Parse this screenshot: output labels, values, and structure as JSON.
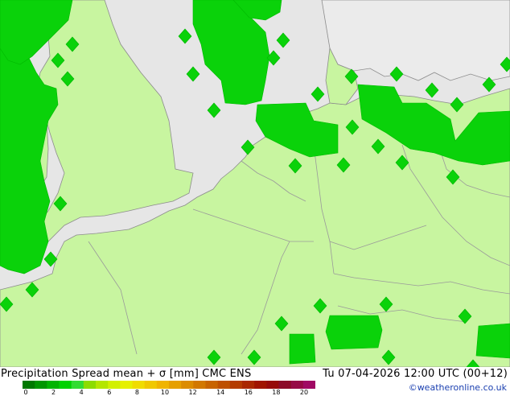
{
  "map": {
    "colors": {
      "sea": "#e6e6e6",
      "land_background": "#ebebeb",
      "land_forecast": "#c8f5a0",
      "precip_blob": "#0ad20a",
      "precip_blob_stroke": "#00b800",
      "border": "#9a9a9a",
      "coast": "#8c8c8c"
    }
  },
  "footer": {
    "title": "Precipitation Spread mean + σ [mm] CMC ENS",
    "datetime": "Tu 07-04-2026 12:00 UTC (00+12)",
    "credit": "©weatheronline.co.uk"
  },
  "legend": {
    "ticks": [
      "0",
      "2",
      "4",
      "6",
      "8",
      "10",
      "12",
      "14",
      "16",
      "18",
      "20"
    ],
    "colors": [
      "#007800",
      "#009600",
      "#00b400",
      "#00d200",
      "#32dc32",
      "#8cdc00",
      "#b4e600",
      "#d2f000",
      "#e6f000",
      "#f0dc00",
      "#f0c800",
      "#f0b400",
      "#e6a000",
      "#dc8c00",
      "#d27800",
      "#c86400",
      "#be5000",
      "#b43c00",
      "#aa2800",
      "#a01400",
      "#960a0a",
      "#8c0a28",
      "#960a46",
      "#a00a64"
    ]
  }
}
